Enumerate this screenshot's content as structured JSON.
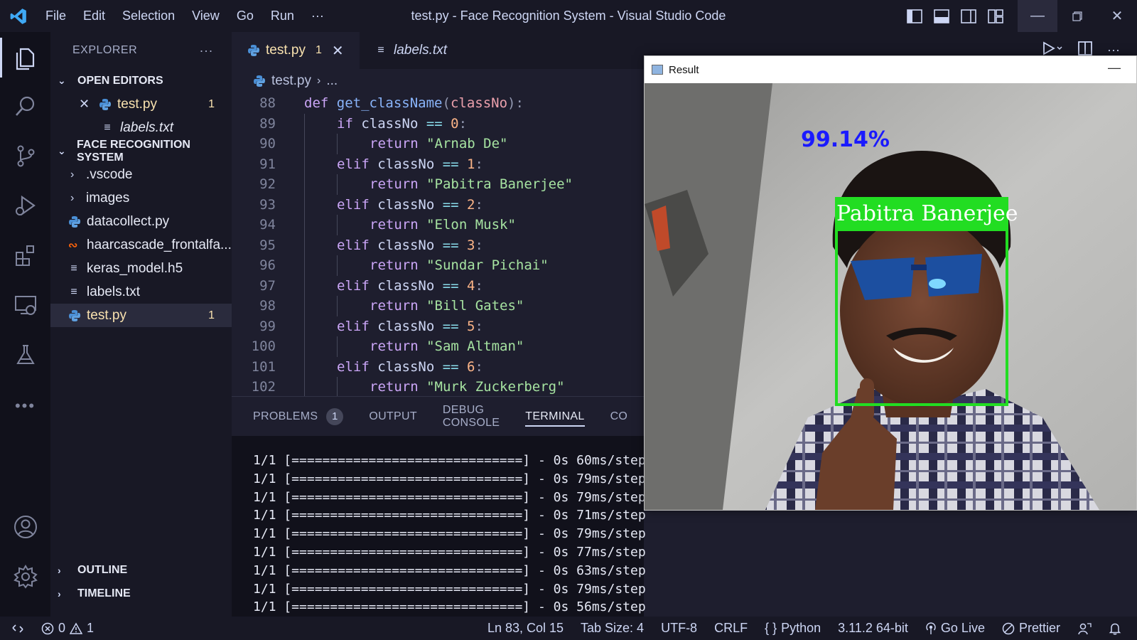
{
  "titlebar": {
    "menu": [
      "File",
      "Edit",
      "Selection",
      "View",
      "Go",
      "Run"
    ],
    "more": "···",
    "window_title": "test.py - Face Recognition System - Visual Studio Code"
  },
  "sidebar": {
    "header": "EXPLORER",
    "header_more": "···",
    "open_editors_label": "OPEN EDITORS",
    "open_editors": [
      {
        "name": "test.py",
        "badge": "1"
      },
      {
        "name": "labels.txt"
      }
    ],
    "folder_label": "FACE RECOGNITION SYSTEM",
    "files": [
      {
        "name": ".vscode",
        "type": "folder"
      },
      {
        "name": "images",
        "type": "folder"
      },
      {
        "name": "datacollect.py",
        "type": "python"
      },
      {
        "name": "haarcascade_frontalfa...",
        "type": "rss"
      },
      {
        "name": "keras_model.h5",
        "type": "text"
      },
      {
        "name": "labels.txt",
        "type": "text"
      },
      {
        "name": "test.py",
        "type": "python",
        "badge": "1"
      }
    ],
    "outline_label": "OUTLINE",
    "timeline_label": "TIMELINE"
  },
  "tabs": {
    "active": {
      "name": "test.py",
      "badge": "1"
    },
    "inactive": {
      "name": "labels.txt"
    }
  },
  "breadcrumb": {
    "file": "test.py",
    "rest": "..."
  },
  "code": {
    "lines": [
      {
        "n": "88",
        "indent": 0,
        "parts": [
          [
            "kw",
            "def "
          ],
          [
            "fn",
            "get_className"
          ],
          [
            "punc",
            "("
          ],
          [
            "param",
            "classNo"
          ],
          [
            "punc",
            "):"
          ]
        ]
      },
      {
        "n": "89",
        "indent": 1,
        "parts": [
          [
            "kw",
            "if "
          ],
          [
            "var",
            "classNo "
          ],
          [
            "op",
            "== "
          ],
          [
            "num",
            "0"
          ],
          [
            "punc",
            ":"
          ]
        ]
      },
      {
        "n": "90",
        "indent": 2,
        "parts": [
          [
            "kw",
            "return "
          ],
          [
            "str",
            "\"Arnab De\""
          ]
        ]
      },
      {
        "n": "91",
        "indent": 1,
        "parts": [
          [
            "kw",
            "elif "
          ],
          [
            "var",
            "classNo "
          ],
          [
            "op",
            "== "
          ],
          [
            "num",
            "1"
          ],
          [
            "punc",
            ":"
          ]
        ]
      },
      {
        "n": "92",
        "indent": 2,
        "parts": [
          [
            "kw",
            "return "
          ],
          [
            "str",
            "\"Pabitra Banerjee\""
          ]
        ]
      },
      {
        "n": "93",
        "indent": 1,
        "parts": [
          [
            "kw",
            "elif "
          ],
          [
            "var",
            "classNo "
          ],
          [
            "op",
            "== "
          ],
          [
            "num",
            "2"
          ],
          [
            "punc",
            ":"
          ]
        ]
      },
      {
        "n": "94",
        "indent": 2,
        "parts": [
          [
            "kw",
            "return "
          ],
          [
            "str",
            "\"Elon Musk\""
          ]
        ]
      },
      {
        "n": "95",
        "indent": 1,
        "parts": [
          [
            "kw",
            "elif "
          ],
          [
            "var",
            "classNo "
          ],
          [
            "op",
            "== "
          ],
          [
            "num",
            "3"
          ],
          [
            "punc",
            ":"
          ]
        ]
      },
      {
        "n": "96",
        "indent": 2,
        "parts": [
          [
            "kw",
            "return "
          ],
          [
            "str",
            "\"Sundar Pichai\""
          ]
        ]
      },
      {
        "n": "97",
        "indent": 1,
        "parts": [
          [
            "kw",
            "elif "
          ],
          [
            "var",
            "classNo "
          ],
          [
            "op",
            "== "
          ],
          [
            "num",
            "4"
          ],
          [
            "punc",
            ":"
          ]
        ]
      },
      {
        "n": "98",
        "indent": 2,
        "parts": [
          [
            "kw",
            "return "
          ],
          [
            "str",
            "\"Bill Gates\""
          ]
        ]
      },
      {
        "n": "99",
        "indent": 1,
        "parts": [
          [
            "kw",
            "elif "
          ],
          [
            "var",
            "classNo "
          ],
          [
            "op",
            "== "
          ],
          [
            "num",
            "5"
          ],
          [
            "punc",
            ":"
          ]
        ]
      },
      {
        "n": "100",
        "indent": 2,
        "parts": [
          [
            "kw",
            "return "
          ],
          [
            "str",
            "\"Sam Altman\""
          ]
        ]
      },
      {
        "n": "101",
        "indent": 1,
        "parts": [
          [
            "kw",
            "elif "
          ],
          [
            "var",
            "classNo "
          ],
          [
            "op",
            "== "
          ],
          [
            "num",
            "6"
          ],
          [
            "punc",
            ":"
          ]
        ]
      },
      {
        "n": "102",
        "indent": 2,
        "parts": [
          [
            "kw",
            "return "
          ],
          [
            "str",
            "\"Murk Zuckerberg\""
          ]
        ]
      }
    ]
  },
  "panel": {
    "tabs": [
      "PROBLEMS",
      "OUTPUT",
      "DEBUG CONSOLE",
      "TERMINAL",
      "CO"
    ],
    "problems_count": "1",
    "active_tab": "TERMINAL",
    "terminal_lines": [
      "1/1 [==============================] - 0s 60ms/step",
      "1/1 [==============================] - 0s 79ms/step",
      "1/1 [==============================] - 0s 79ms/step",
      "1/1 [==============================] - 0s 71ms/step",
      "1/1 [==============================] - 0s 79ms/step",
      "1/1 [==============================] - 0s 77ms/step",
      "1/1 [==============================] - 0s 63ms/step",
      "1/1 [==============================] - 0s 79ms/step",
      "1/1 [==============================] - 0s 56ms/step"
    ]
  },
  "result": {
    "window_title": "Result",
    "confidence": "99.14%",
    "name_label": "Pabitra Banerjee",
    "box_color": "#22dd22",
    "confidence_color": "#1a1aff"
  },
  "statusbar": {
    "errors": "0",
    "warnings": "1",
    "position": "Ln 83, Col 15",
    "tab_size": "Tab Size: 4",
    "encoding": "UTF-8",
    "eol": "CRLF",
    "language": "Python",
    "interpreter": "3.11.2 64-bit",
    "go_live": "Go Live",
    "prettier": "Prettier"
  },
  "colors": {
    "accent_yellow": "#f9e2af",
    "python_blue": "#4a8fd6"
  }
}
